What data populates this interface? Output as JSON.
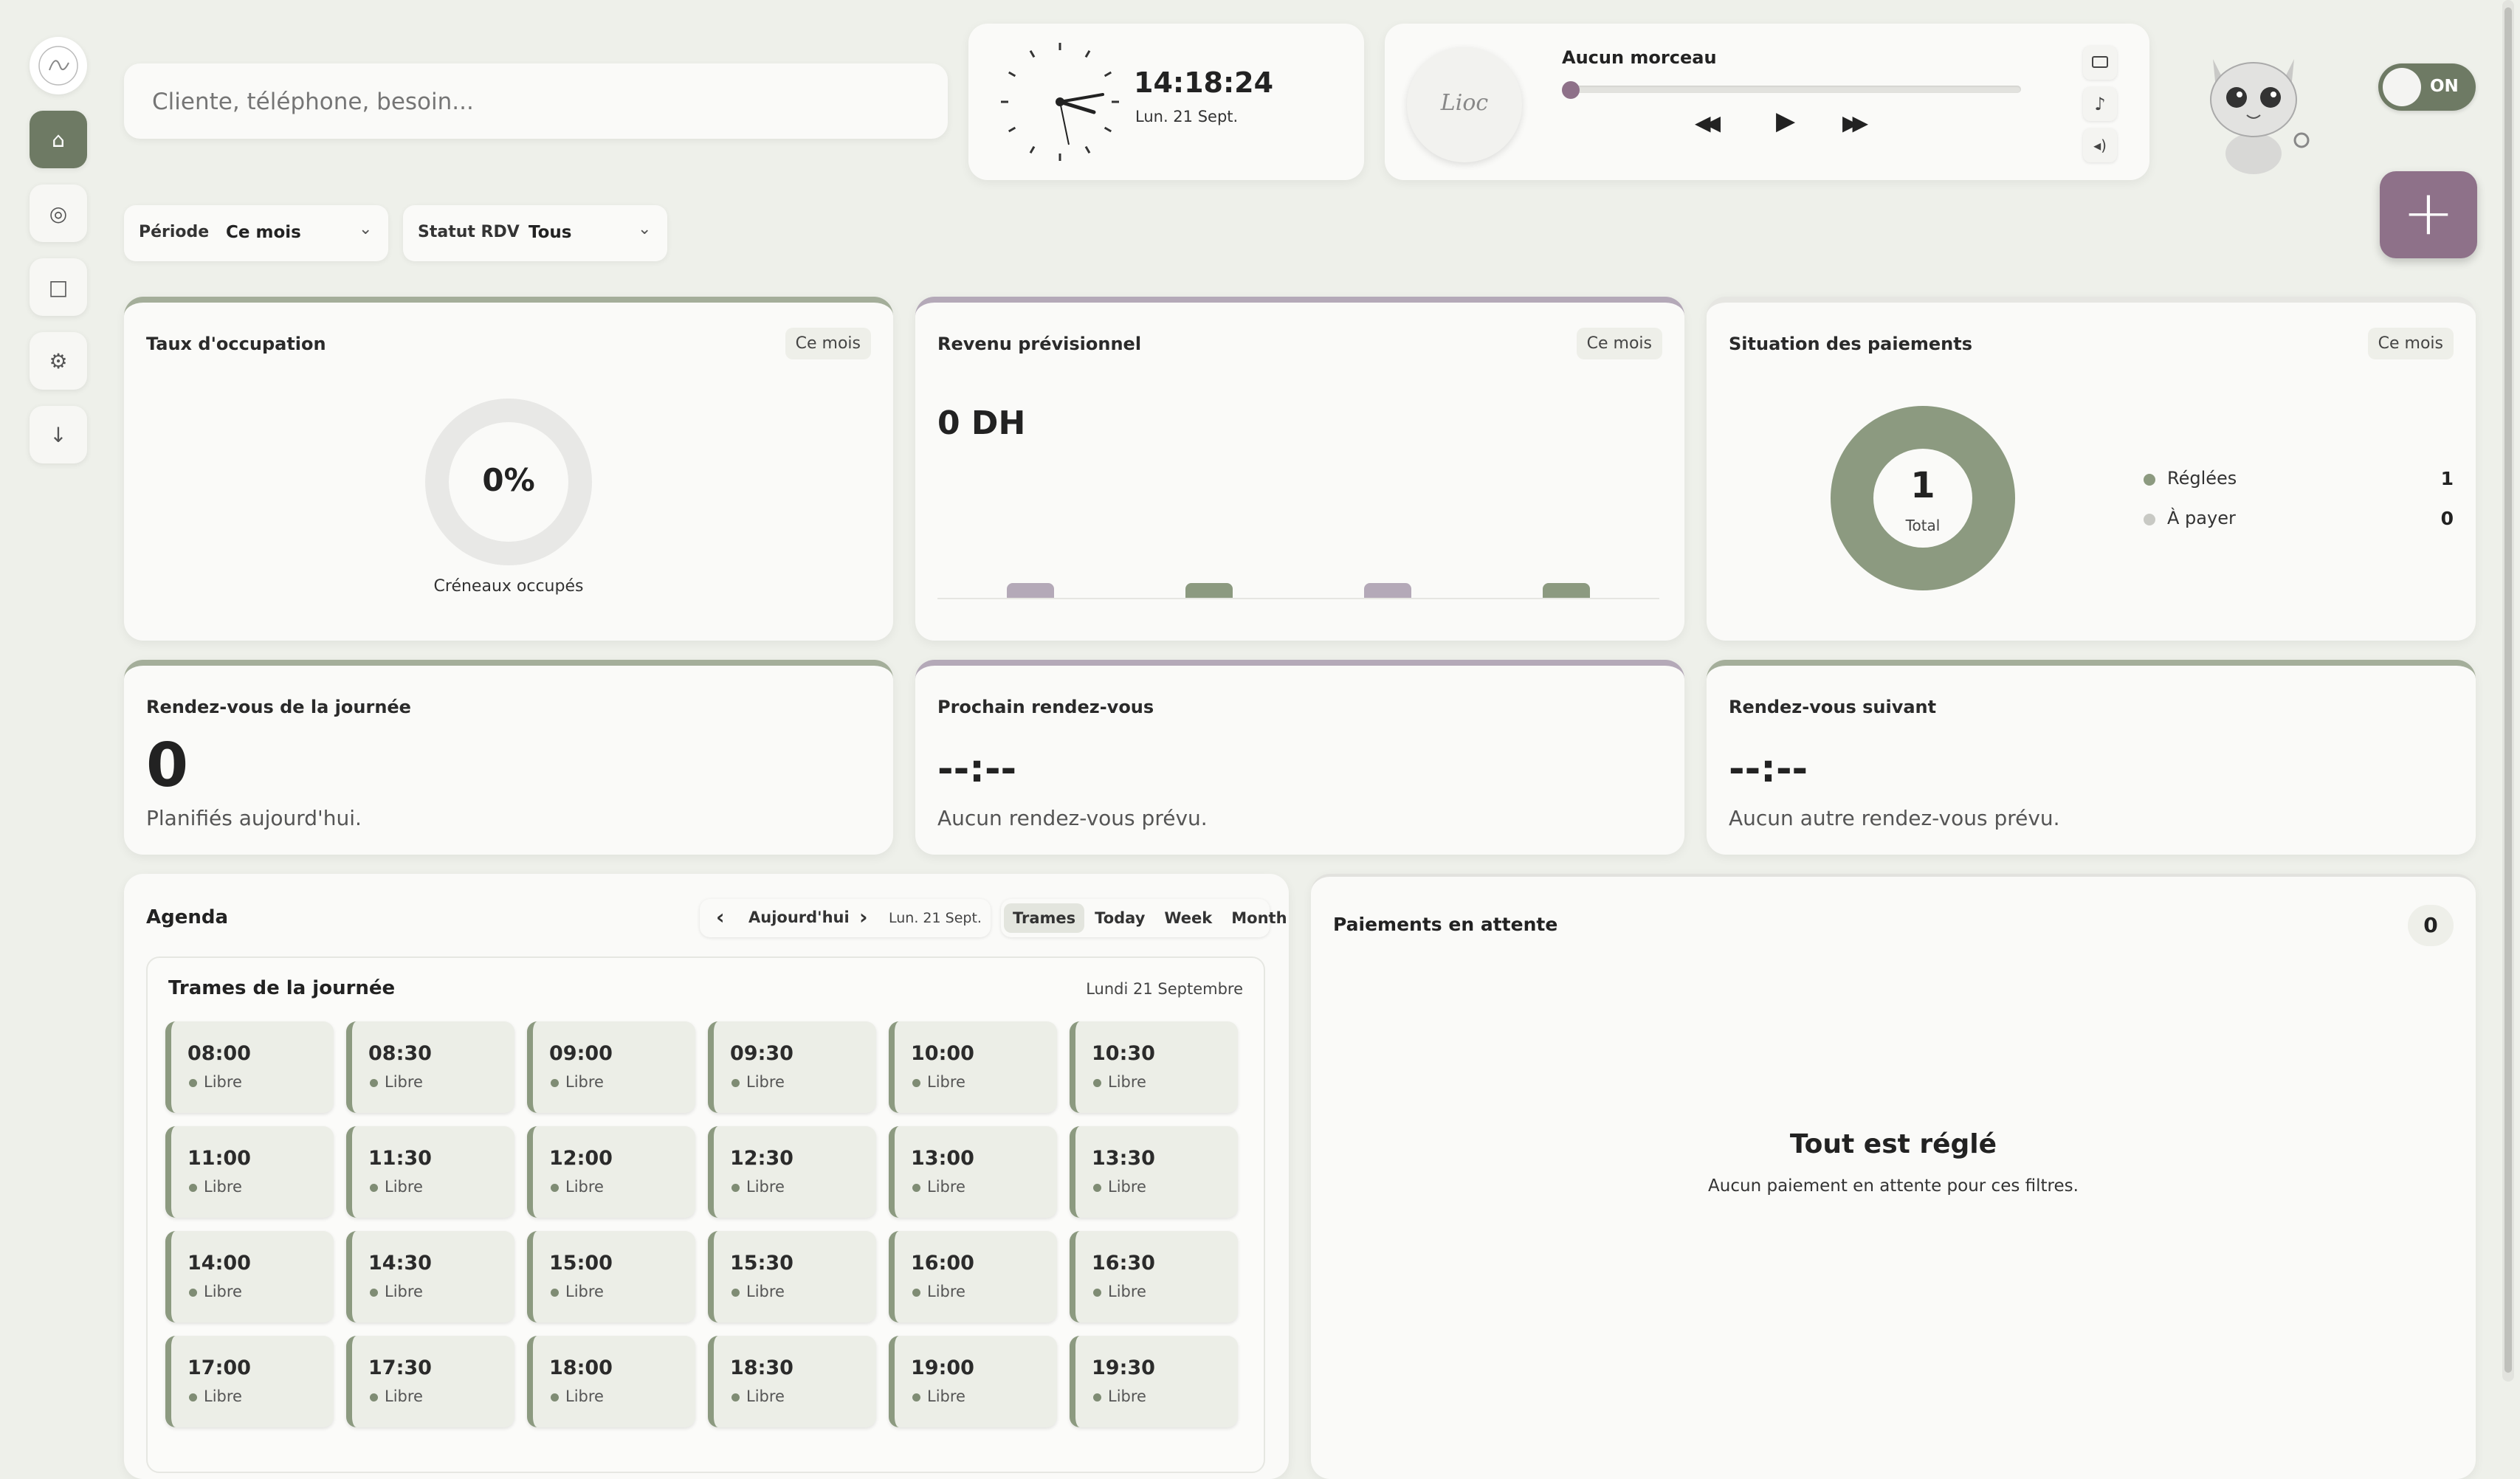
{
  "sidebar": {
    "items": [
      {
        "name": "logo",
        "icon": "logo-badge"
      },
      {
        "name": "home",
        "icon": "home-icon",
        "glyph": "⌂",
        "active": true
      },
      {
        "name": "clients",
        "icon": "target-icon",
        "glyph": "◎"
      },
      {
        "name": "documents",
        "icon": "square-icon",
        "glyph": "□"
      },
      {
        "name": "settings",
        "icon": "gear-icon",
        "glyph": "⚙"
      },
      {
        "name": "download",
        "icon": "download-icon",
        "glyph": "↓"
      }
    ]
  },
  "search": {
    "placeholder": "Cliente, téléphone, besoin..."
  },
  "clock": {
    "time": "14:18:24",
    "date": "Lun. 21 Sept."
  },
  "player": {
    "title": "Aucun morceau",
    "logo_text": "Lioc",
    "prev_glyph": "◀◀",
    "play_glyph": "▶",
    "next_glyph": "▶▶",
    "side_icons": [
      "screen-icon",
      "music-note-icon",
      "volume-icon"
    ],
    "progress": 0
  },
  "toggle": {
    "label": "ON",
    "state": true
  },
  "add_button": {
    "glyph": "+"
  },
  "filters": {
    "periode": {
      "label": "Période",
      "value": "Ce mois"
    },
    "statut": {
      "label": "Statut RDV",
      "value": "Tous"
    }
  },
  "occupation": {
    "title": "Taux d'occupation",
    "chip": "Ce mois",
    "value": "0%",
    "caption": "Créneaux occupés"
  },
  "revenue": {
    "title": "Revenu prévisionnel",
    "chip": "Ce mois",
    "value": "0 DH"
  },
  "payments_status": {
    "title": "Situation des paiements",
    "chip": "Ce mois",
    "total": "1",
    "total_label": "Total",
    "legend": [
      {
        "label": "Réglées",
        "value": "1",
        "color": "#8c9a80"
      },
      {
        "label": "À payer",
        "value": "0",
        "color": "#c8c9c4"
      }
    ]
  },
  "today_rdv": {
    "title": "Rendez-vous de la journée",
    "value": "0",
    "caption": "Planifiés aujourd'hui."
  },
  "next_rdv": {
    "title": "Prochain rendez-vous",
    "value": "--:--",
    "caption": "Aucun rendez-vous prévu."
  },
  "following_rdv": {
    "title": "Rendez-vous suivant",
    "value": "--:--",
    "caption": "Aucun autre rendez-vous prévu."
  },
  "agenda": {
    "title": "Agenda",
    "prev": "‹",
    "today_btn": "Aujourd'hui",
    "next": "›",
    "date": "Lun. 21 Sept.",
    "views": [
      {
        "label": "Trames",
        "active": true
      },
      {
        "label": "Today"
      },
      {
        "label": "Week"
      },
      {
        "label": "Month"
      }
    ],
    "grid_title": "Trames de la journée",
    "grid_date": "Lundi 21 Septembre",
    "slots": [
      {
        "time": "08:00",
        "status": "Libre"
      },
      {
        "time": "08:30",
        "status": "Libre"
      },
      {
        "time": "09:00",
        "status": "Libre"
      },
      {
        "time": "09:30",
        "status": "Libre"
      },
      {
        "time": "10:00",
        "status": "Libre"
      },
      {
        "time": "10:30",
        "status": "Libre"
      },
      {
        "time": "11:00",
        "status": "Libre"
      },
      {
        "time": "11:30",
        "status": "Libre"
      },
      {
        "time": "12:00",
        "status": "Libre"
      },
      {
        "time": "12:30",
        "status": "Libre"
      },
      {
        "time": "13:00",
        "status": "Libre"
      },
      {
        "time": "13:30",
        "status": "Libre"
      },
      {
        "time": "14:00",
        "status": "Libre"
      },
      {
        "time": "14:30",
        "status": "Libre"
      },
      {
        "time": "15:00",
        "status": "Libre"
      },
      {
        "time": "15:30",
        "status": "Libre"
      },
      {
        "time": "16:00",
        "status": "Libre"
      },
      {
        "time": "16:30",
        "status": "Libre"
      },
      {
        "time": "17:00",
        "status": "Libre"
      },
      {
        "time": "17:30",
        "status": "Libre"
      },
      {
        "time": "18:00",
        "status": "Libre"
      },
      {
        "time": "18:30",
        "status": "Libre"
      },
      {
        "time": "19:00",
        "status": "Libre"
      },
      {
        "time": "19:30",
        "status": "Libre"
      }
    ]
  },
  "pending_payments": {
    "title": "Paiements en attente",
    "count": "0",
    "empty_title": "Tout est réglé",
    "empty_caption": "Aucun paiement en attente pour ces filtres."
  },
  "colors": {
    "accent": "#6e7a64",
    "sage": "#8c9a80",
    "mauve": "#b4a9b8",
    "plum": "#8e7189"
  }
}
